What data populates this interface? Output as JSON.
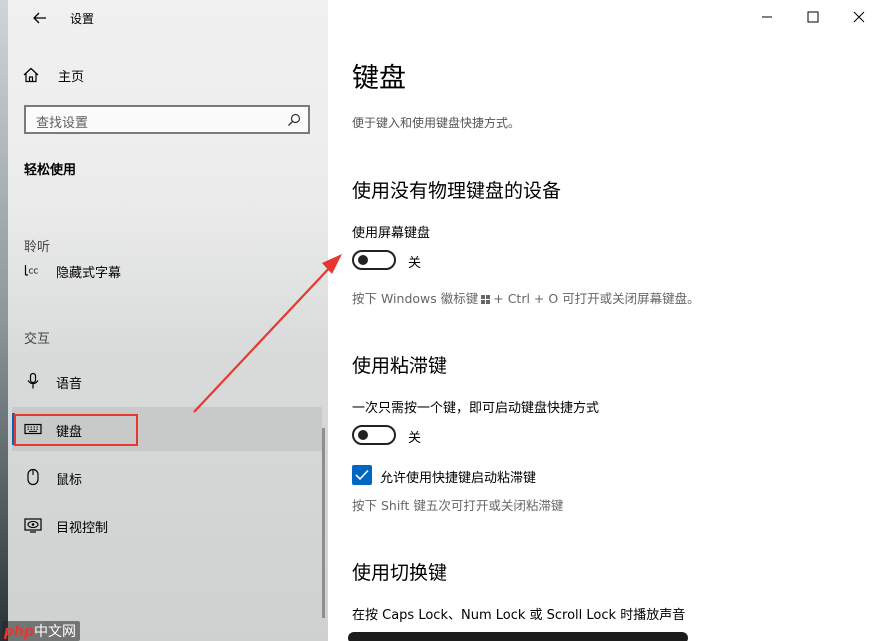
{
  "window": {
    "title": "设置",
    "controls": {
      "minimize": "minimize-icon",
      "maximize": "maximize-icon",
      "close": "close-icon"
    }
  },
  "sidebar": {
    "home_label": "主页",
    "search_placeholder": "查找设置",
    "section_title": "轻松使用",
    "groups": [
      {
        "header": "聆听",
        "items": [
          {
            "label": "隐藏式字幕",
            "icon": "closed-caption-icon"
          }
        ]
      },
      {
        "header": "交互",
        "items": [
          {
            "label": "语音",
            "icon": "microphone-icon"
          },
          {
            "label": "键盘",
            "icon": "keyboard-icon",
            "selected": true
          },
          {
            "label": "鼠标",
            "icon": "mouse-icon"
          },
          {
            "label": "目视控制",
            "icon": "eye-control-icon"
          }
        ]
      }
    ]
  },
  "main": {
    "title": "键盘",
    "description": "便于键入和使用键盘快捷方式。",
    "sections": [
      {
        "heading": "使用没有物理键盘的设备",
        "setting_label": "使用屏幕键盘",
        "toggle_state": "关",
        "hint_part1": "按下 Windows 徽标键",
        "hint_part2": "+ Ctrl + O 可打开或关闭屏幕键盘。"
      },
      {
        "heading": "使用粘滞键",
        "setting_label": "一次只需按一个键，即可启动键盘快捷方式",
        "toggle_state": "关",
        "checkbox_label": "允许使用快捷键启动粘滞键",
        "checkbox_checked": true,
        "hint": "按下 Shift 键五次可打开或关闭粘滞键"
      },
      {
        "heading": "使用切换键",
        "setting_label": "在按 Caps Lock、Num Lock 或 Scroll Lock 时播放声音"
      }
    ]
  },
  "annotations": {
    "highlight_color": "#e8372f"
  },
  "watermark": {
    "brand": "php",
    "text": "中文网"
  },
  "colors": {
    "accent": "#0067c0"
  }
}
